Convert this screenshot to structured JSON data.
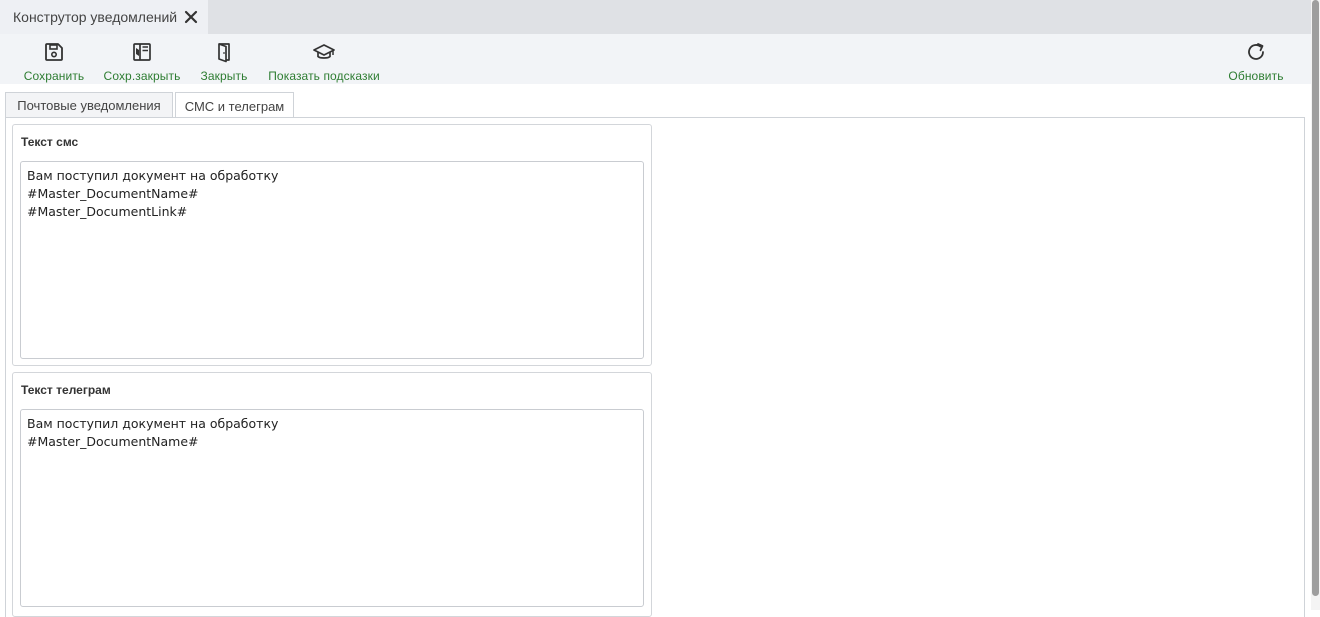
{
  "window_tab": {
    "title": "Конструтор уведомлений",
    "close_icon": "close-icon"
  },
  "toolbar": {
    "save_label": "Сохранить",
    "save_close_label": "Сохр.закрыть",
    "close_label": "Закрыть",
    "hints_label": "Показать подсказки",
    "refresh_label": "Обновить",
    "accent_color": "#2e7d32"
  },
  "tabs": [
    {
      "label": "Почтовые уведомления",
      "active": false
    },
    {
      "label": "СМС и телеграм",
      "active": true
    }
  ],
  "sms": {
    "title": "Текст смс",
    "text": "Вам поступил документ на обработку\n#Master_DocumentName#\n#Master_DocumentLink#"
  },
  "telegram": {
    "title": "Текст телеграм",
    "text": "Вам поступил документ на обработку\n#Master_DocumentName#"
  }
}
